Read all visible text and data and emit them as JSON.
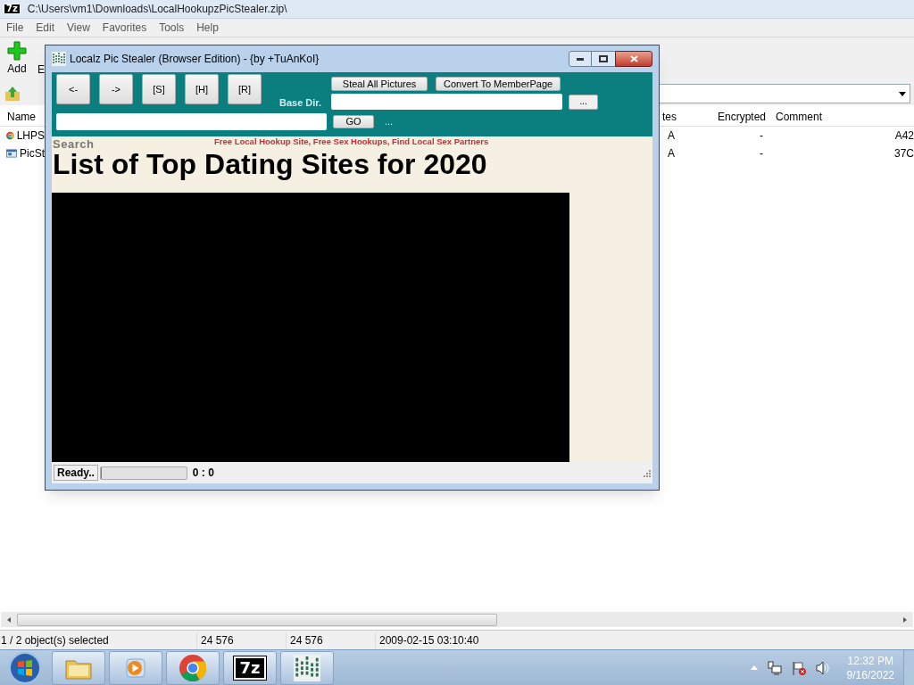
{
  "main_window": {
    "logo": "7z",
    "title": "C:\\Users\\vm1\\Downloads\\LocalHookupzPicStealer.zip\\",
    "menu": [
      "File",
      "Edit",
      "View",
      "Favorites",
      "Tools",
      "Help"
    ],
    "toolbar": [
      "Add",
      "E"
    ],
    "columns": [
      "Name",
      "tes",
      "Encrypted",
      "Comment"
    ],
    "rows": [
      {
        "kind": "chrome",
        "name": "LHPS",
        "attributes": "A",
        "encrypted": "-",
        "column_5": "A42"
      },
      {
        "kind": "app",
        "name": "PicSt",
        "attributes": "A",
        "encrypted": "-",
        "column_5": "37C"
      }
    ],
    "status_bar": [
      "1 / 2 object(s) selected",
      "24 576",
      "24 576",
      "2009-02-15 03:10:40"
    ]
  },
  "dialog": {
    "title": "Localz Pic Stealer (Browser Edition) - {by +TuAnKoI}",
    "nav_buttons": [
      "<-",
      "->",
      "[S]",
      "[H]",
      "[R]"
    ],
    "base_dir_label": "Base Dir.",
    "actions": [
      "Steal All Pictures",
      "Convert To MemberPage"
    ],
    "browse_button": "...",
    "go_button": "GO",
    "ellipsis": "...",
    "page": {
      "search_label": "Search",
      "links": "Free Local Hookup Site, Free Sex Hookups, Find Local Sex Partners",
      "heading": "List of Top Dating Sites for 2020"
    },
    "status": {
      "text": "Ready..",
      "progress": {
        "level": 0
      },
      "counter": "0 : 0"
    }
  },
  "taskbar": {
    "apps": [
      {
        "kind": "explorer"
      },
      {
        "kind": "media"
      },
      {
        "kind": "chrome"
      },
      {
        "kind": "sevenzip",
        "label": "7z"
      },
      {
        "kind": "app"
      }
    ],
    "tray": {
      "time": "12:32 PM",
      "date": "9/16/2022"
    }
  }
}
